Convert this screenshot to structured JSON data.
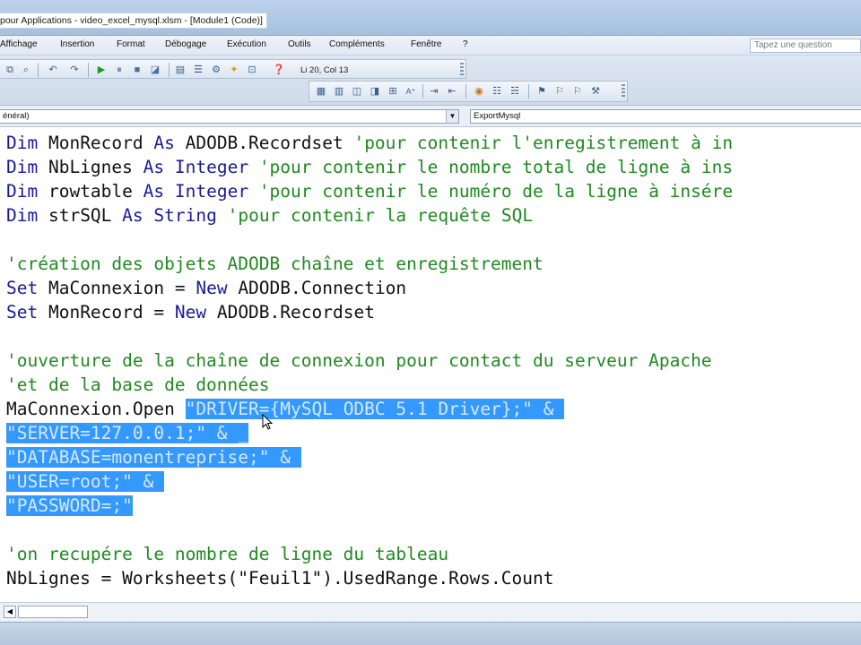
{
  "window": {
    "title": "pour Applications - video_excel_mysql.xlsm - [Module1 (Code)]"
  },
  "menu": {
    "items": [
      "Affichage",
      "Insertion",
      "Format",
      "Débogage",
      "Exécution",
      "Outils",
      "Compléments",
      "Fenêtre",
      "?"
    ],
    "help_placeholder": "Tapez une question"
  },
  "toolbar": {
    "position": "Li 20, Col 13"
  },
  "procedure_bar": {
    "object": "énéral)",
    "procedure": "ExportMysql"
  },
  "code": {
    "lines": [
      {
        "parts": [
          {
            "t": "Dim",
            "c": "kw"
          },
          {
            "t": " MonRecord ",
            "c": ""
          },
          {
            "t": "As",
            "c": "kw"
          },
          {
            "t": " ADODB.Recordset ",
            "c": ""
          },
          {
            "t": "'pour contenir l'enregistrement à in",
            "c": "cm"
          }
        ]
      },
      {
        "parts": [
          {
            "t": "Dim",
            "c": "kw"
          },
          {
            "t": " NbLignes ",
            "c": ""
          },
          {
            "t": "As",
            "c": "kw"
          },
          {
            "t": " ",
            "c": ""
          },
          {
            "t": "Integer",
            "c": "kw"
          },
          {
            "t": " ",
            "c": ""
          },
          {
            "t": "'pour contenir le nombre total de ligne à ins",
            "c": "cm"
          }
        ]
      },
      {
        "parts": [
          {
            "t": "Dim",
            "c": "kw"
          },
          {
            "t": " rowtable ",
            "c": ""
          },
          {
            "t": "As",
            "c": "kw"
          },
          {
            "t": " ",
            "c": ""
          },
          {
            "t": "Integer",
            "c": "kw"
          },
          {
            "t": " ",
            "c": ""
          },
          {
            "t": "'pour contenir le numéro de la ligne à insére",
            "c": "cm"
          }
        ]
      },
      {
        "parts": [
          {
            "t": "Dim",
            "c": "kw"
          },
          {
            "t": " strSQL ",
            "c": ""
          },
          {
            "t": "As",
            "c": "kw"
          },
          {
            "t": " ",
            "c": ""
          },
          {
            "t": "String",
            "c": "kw"
          },
          {
            "t": " ",
            "c": ""
          },
          {
            "t": "'pour contenir la requête SQL",
            "c": "cm"
          }
        ]
      },
      {
        "parts": []
      },
      {
        "parts": [
          {
            "t": "'création des objets ADODB chaîne et enregistrement",
            "c": "cm"
          }
        ]
      },
      {
        "parts": [
          {
            "t": "Set",
            "c": "kw"
          },
          {
            "t": " MaConnexion = ",
            "c": ""
          },
          {
            "t": "New",
            "c": "kw"
          },
          {
            "t": " ADODB.Connection",
            "c": ""
          }
        ]
      },
      {
        "parts": [
          {
            "t": "Set",
            "c": "kw"
          },
          {
            "t": " MonRecord = ",
            "c": ""
          },
          {
            "t": "New",
            "c": "kw"
          },
          {
            "t": " ADODB.Recordset",
            "c": ""
          }
        ]
      },
      {
        "parts": []
      },
      {
        "parts": [
          {
            "t": "'ouverture de la chaîne de connexion pour contact du serveur Apache",
            "c": "cm"
          }
        ]
      },
      {
        "parts": [
          {
            "t": "'et de la base de données",
            "c": "cm"
          }
        ]
      },
      {
        "parts": [
          {
            "t": "MaConnexion.Open ",
            "c": ""
          },
          {
            "t": "\"DRIVER={MySQL ODBC 5.1 Driver};\" & ",
            "c": "sel"
          }
        ]
      },
      {
        "parts": [
          {
            "t": "\"SERVER=127.0.0.1;\" & _",
            "c": "sel"
          }
        ]
      },
      {
        "parts": [
          {
            "t": "\"DATABASE=monentreprise;\" & ",
            "c": "sel"
          }
        ]
      },
      {
        "parts": [
          {
            "t": "\"USER=root;\" & ",
            "c": "sel"
          }
        ]
      },
      {
        "parts": [
          {
            "t": "\"PASSWORD=;\"",
            "c": "sel"
          }
        ]
      },
      {
        "parts": []
      },
      {
        "parts": [
          {
            "t": "'on recupére le nombre de ligne du tableau",
            "c": "cm"
          }
        ]
      },
      {
        "parts": [
          {
            "t": "NbLignes = Worksheets(\"Feuil1\").UsedRange.Rows.Count",
            "c": ""
          }
        ]
      }
    ]
  }
}
